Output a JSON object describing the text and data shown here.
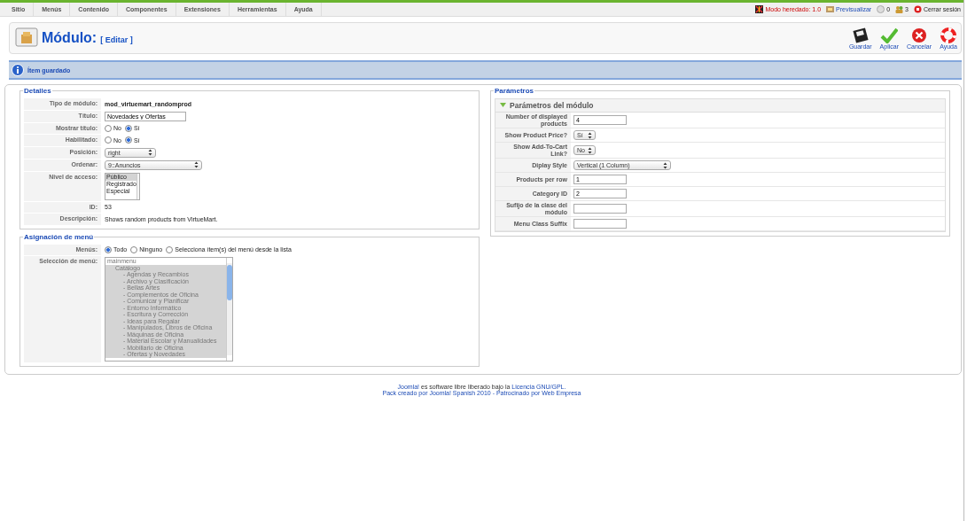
{
  "menubar": {
    "items": [
      {
        "label": "Sitio"
      },
      {
        "label": "Menús"
      },
      {
        "label": "Contenido"
      },
      {
        "label": "Componentes"
      },
      {
        "label": "Extensiones"
      },
      {
        "label": "Herramientas"
      },
      {
        "label": "Ayuda"
      }
    ],
    "status": [
      {
        "kind": "legacy",
        "text": "Modo heredado: 1.0"
      },
      {
        "kind": "preview",
        "text": "Previsualizar"
      },
      {
        "kind": "messages",
        "text": "0"
      },
      {
        "kind": "users",
        "text": "3"
      },
      {
        "kind": "logout",
        "text": "Cerrar sesión"
      }
    ]
  },
  "toolbar": {
    "title": "Módulo:",
    "subtitle": "[ Editar ]",
    "buttons": [
      {
        "kind": "save",
        "label": "Guardar"
      },
      {
        "kind": "apply",
        "label": "Aplicar"
      },
      {
        "kind": "cancel",
        "label": "Cancelar"
      },
      {
        "kind": "help",
        "label": "Ayuda"
      }
    ]
  },
  "message": "Ítem guardado",
  "details": {
    "legend": "Detalles",
    "rows": [
      {
        "kind": "strong",
        "label": "Tipo de módulo:",
        "value": "mod_virtuemart_randomprod"
      },
      {
        "kind": "input",
        "label": "Título:",
        "value": "Novedades y Ofertas"
      },
      {
        "kind": "radio",
        "label": "Mostrar título:",
        "options": [
          {
            "label": "No",
            "selected": false
          },
          {
            "label": "Sí",
            "selected": true
          }
        ]
      },
      {
        "kind": "radio",
        "label": "Habilitado:",
        "options": [
          {
            "label": "No",
            "selected": false
          },
          {
            "label": "Sí",
            "selected": true
          }
        ]
      },
      {
        "kind": "select",
        "label": "Posición:",
        "value": "right"
      },
      {
        "kind": "select",
        "label": "Ordenar:",
        "value": "9::Anuncios"
      },
      {
        "kind": "listbox",
        "label": "Nivel de acceso:",
        "options": [
          {
            "label": "Público",
            "selected": true
          },
          {
            "label": "Registrado",
            "selected": false
          },
          {
            "label": "Especial",
            "selected": false
          }
        ]
      },
      {
        "kind": "text",
        "label": "ID:",
        "value": "53"
      },
      {
        "kind": "text",
        "label": "Descripción:",
        "value": "Shows random products from VirtueMart."
      }
    ]
  },
  "menu_assignment": {
    "legend": "Asignación de menú",
    "menus_label": "Menús:",
    "menus_options": [
      {
        "label": "Todo",
        "selected": true
      },
      {
        "label": "Ninguno",
        "selected": false
      },
      {
        "label": "Selecciona ítem(s) del menú desde la lista",
        "selected": false
      }
    ],
    "selection_label": "Selección de menú:",
    "tree": [
      {
        "label": "mainmenu",
        "selected": false,
        "children": [
          {
            "label": "Catálogo",
            "selected": true,
            "children": [
              {
                "label": "- Agendas y Recambios",
                "selected": true
              },
              {
                "label": "- Archivo y Clasificación",
                "selected": true
              },
              {
                "label": "- Bellas Artes",
                "selected": true
              },
              {
                "label": "- Complementos de Oficina",
                "selected": true
              },
              {
                "label": "- Comunicar y Planificar",
                "selected": true
              },
              {
                "label": "- Entorno Informático",
                "selected": true
              },
              {
                "label": "- Escritura y Corrección",
                "selected": true
              },
              {
                "label": "- Ideas para Regalar",
                "selected": true
              },
              {
                "label": "- Manipulados, Libros de Oficina",
                "selected": true
              },
              {
                "label": "- Máquinas de Oficina",
                "selected": true
              },
              {
                "label": "- Material Escolar y Manualidades",
                "selected": true
              },
              {
                "label": "- Mobiliario de Oficina",
                "selected": true
              },
              {
                "label": "- Ofertas y Novedades",
                "selected": true
              }
            ]
          }
        ]
      }
    ]
  },
  "parameters": {
    "legend": "Parámetros",
    "section": {
      "title": "Parámetros del módulo",
      "expanded": true
    },
    "rows": [
      {
        "kind": "input",
        "label": "Number of displayed products",
        "value": "4"
      },
      {
        "kind": "select",
        "label": "Show Product Price?",
        "value": "Sí"
      },
      {
        "kind": "select",
        "label": "Show Add-To-Cart Link?",
        "value": "No"
      },
      {
        "kind": "select",
        "label": "Diplay Style",
        "value": "Vertical (1 Column)"
      },
      {
        "kind": "input",
        "label": "Products per row",
        "value": "1"
      },
      {
        "kind": "input",
        "label": "Category ID",
        "value": "2"
      },
      {
        "kind": "input",
        "label": "Sufijo de la clase del módulo"
      },
      {
        "kind": "input",
        "label": "Menu Class Suffix"
      }
    ]
  },
  "footer": {
    "line1": [
      {
        "kind": "link",
        "text": "Joomla!"
      },
      {
        "kind": "text",
        "text": " es software libre liberado bajo la "
      },
      {
        "kind": "link",
        "text": "Licencia GNU/GPL."
      }
    ],
    "line2": "Pack creado por Joomla! Spanish 2010 - Patrocinado por Web Empresa"
  }
}
